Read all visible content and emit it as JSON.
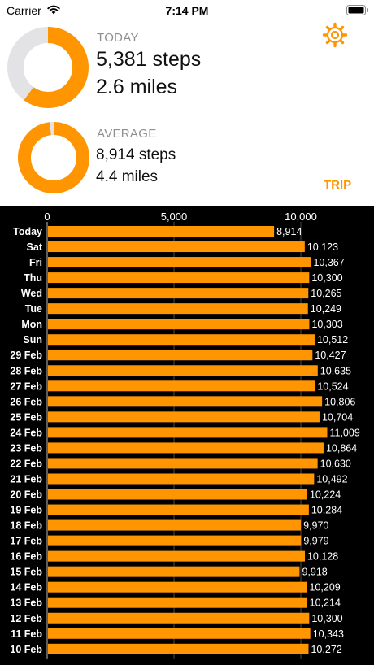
{
  "status": {
    "carrier": "Carrier",
    "time": "7:14 PM"
  },
  "today": {
    "label": "TODAY",
    "steps": "5,381 steps",
    "miles": "2.6 miles",
    "progress": 0.6
  },
  "average": {
    "label": "AVERAGE",
    "steps": "8,914 steps",
    "miles": "4.4 miles",
    "progress": 0.98
  },
  "buttons": {
    "trip_label": "TRIP",
    "settings_icon": "gear-icon"
  },
  "colors": {
    "accent": "#ff9500",
    "ring_track": "#e3e3e6",
    "chart_bg": "#000000"
  },
  "chart_data": {
    "type": "bar",
    "orientation": "horizontal",
    "xlim": [
      0,
      10000
    ],
    "xticks": [
      0,
      5000,
      10000
    ],
    "xtick_labels": [
      "0",
      "5,000",
      "10,000"
    ],
    "grid": true,
    "categories": [
      "Today",
      "Sat",
      "Fri",
      "Thu",
      "Wed",
      "Tue",
      "Mon",
      "Sun",
      "29 Feb",
      "28 Feb",
      "27 Feb",
      "26 Feb",
      "25 Feb",
      "24 Feb",
      "23 Feb",
      "22 Feb",
      "21 Feb",
      "20 Feb",
      "19 Feb",
      "18 Feb",
      "17 Feb",
      "16 Feb",
      "15 Feb",
      "14 Feb",
      "13 Feb",
      "12 Feb",
      "11 Feb",
      "10 Feb"
    ],
    "values": [
      8914,
      10123,
      10367,
      10300,
      10265,
      10249,
      10303,
      10512,
      10427,
      10635,
      10524,
      10806,
      10704,
      11009,
      10864,
      10630,
      10492,
      10224,
      10284,
      9970,
      9979,
      10128,
      9918,
      10209,
      10214,
      10300,
      10343,
      10272
    ],
    "value_labels": [
      "8,914",
      "10,123",
      "10,367",
      "10,300",
      "10,265",
      "10,249",
      "10,303",
      "10,512",
      "10,427",
      "10,635",
      "10,524",
      "10,806",
      "10,704",
      "11,009",
      "10,864",
      "10,630",
      "10,492",
      "10,224",
      "10,284",
      "9,970",
      "9,979",
      "10,128",
      "9,918",
      "10,209",
      "10,214",
      "10,300",
      "10,343",
      "10,272"
    ]
  }
}
